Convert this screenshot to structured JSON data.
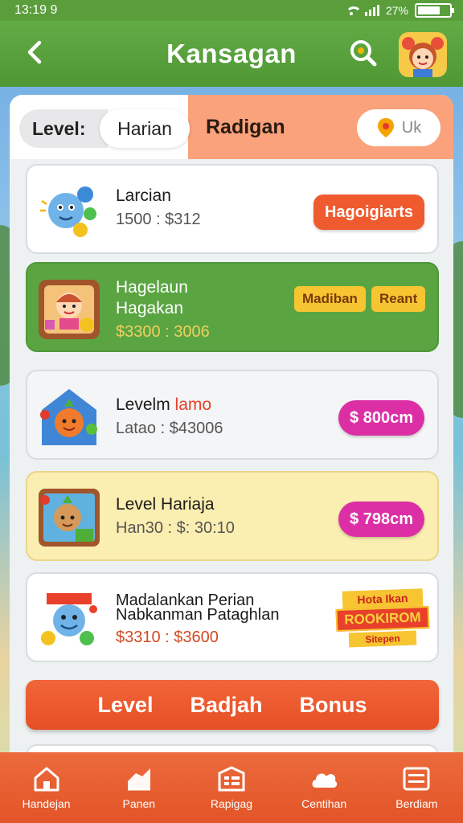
{
  "status_bar": {
    "time": "13:19 9",
    "right_text": "27%"
  },
  "header": {
    "title": "Kansagan"
  },
  "tabs": {
    "level_label": "Level:",
    "harian_label": "Harian",
    "radigan_label": "Radigan",
    "like_label": "Uk"
  },
  "cards": [
    {
      "title": "Larcian",
      "subtitle": "1500 : $312",
      "button": "Hagoigiarts",
      "icon": "blue-mascot-icon"
    },
    {
      "title": "Hagelaun",
      "title2": "Hagakan",
      "subtitle": "$3300 : 3006",
      "tag1": "Madiban",
      "tag2": "Reant",
      "icon": "girl-portrait-icon"
    },
    {
      "title": "Levelm",
      "title_accent": "lamo",
      "subtitle": "Latao : $43006",
      "button": "$ 800cm",
      "icon": "carrot-house-icon"
    },
    {
      "title": "Level Hariaja",
      "subtitle": "Han30 : $: 30:10",
      "button": "$ 798cm",
      "icon": "onion-shop-icon"
    },
    {
      "title": "Madalankan Perian",
      "title2": "Nabkanman Pataghlan",
      "subtitle": "$3310 : $3600",
      "badge_top": "Hota Ikan",
      "badge_mid": "ROOKIROM",
      "badge_bottom": "Sitepen",
      "icon": "smiling-cart-icon"
    }
  ],
  "bonus_bar": {
    "word1": "Level",
    "word2": "Badjah",
    "word3": "Bonus"
  },
  "bottom_nav": [
    {
      "label": "Handejan",
      "icon": "home-icon"
    },
    {
      "label": "Panen",
      "icon": "field-icon"
    },
    {
      "label": "Rapigag",
      "icon": "list-board-icon"
    },
    {
      "label": "Centihan",
      "icon": "cloud-icon"
    },
    {
      "label": "Berdiam",
      "icon": "menu-icon"
    }
  ],
  "colors": {
    "header_green": "#5aa542",
    "accent_orange": "#ef5b2f",
    "magenta": "#dc2fa5",
    "salmon_tab": "#f9a27c",
    "yellow_card": "#fbeeb1"
  }
}
